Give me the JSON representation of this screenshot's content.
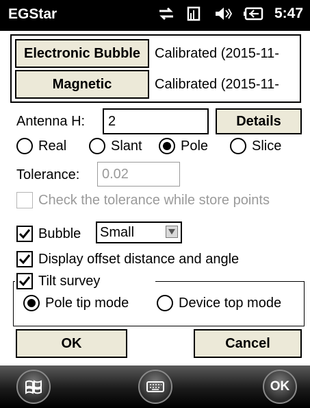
{
  "statusbar": {
    "title": "EGStar",
    "time": "5:47",
    "icons": [
      "connectivity-icon",
      "signal-icon",
      "volume-icon",
      "battery-icon"
    ]
  },
  "calibration": {
    "electronic_bubble_label": "Electronic Bubble",
    "electronic_bubble_status": "Calibrated (2015-11-",
    "magnetic_label": "Magnetic",
    "magnetic_status": "Calibrated (2015-11-"
  },
  "antenna": {
    "label": "Antenna H:",
    "value": "2",
    "details_label": "Details",
    "modes": [
      {
        "label": "Real",
        "selected": false
      },
      {
        "label": "Slant",
        "selected": false
      },
      {
        "label": "Pole",
        "selected": true
      },
      {
        "label": "Slice",
        "selected": false
      }
    ]
  },
  "tolerance": {
    "label": "Tolerance:",
    "value": "0.02",
    "check_label": "Check the tolerance while store points",
    "checked": false
  },
  "bubble": {
    "label": "Bubble",
    "checked": true,
    "size_selected": "Small"
  },
  "display_offset": {
    "label": "Display offset distance and angle",
    "checked": true
  },
  "tilt_survey": {
    "label": "Tilt survey",
    "checked": true,
    "modes": [
      {
        "label": "Pole tip mode",
        "selected": true
      },
      {
        "label": "Device top mode",
        "selected": false
      }
    ]
  },
  "actions": {
    "ok_label": "OK",
    "cancel_label": "Cancel"
  },
  "taskbar": {
    "start_icon": "windows-start-icon",
    "keyboard_icon": "keyboard-icon",
    "ok_label": "OK"
  }
}
